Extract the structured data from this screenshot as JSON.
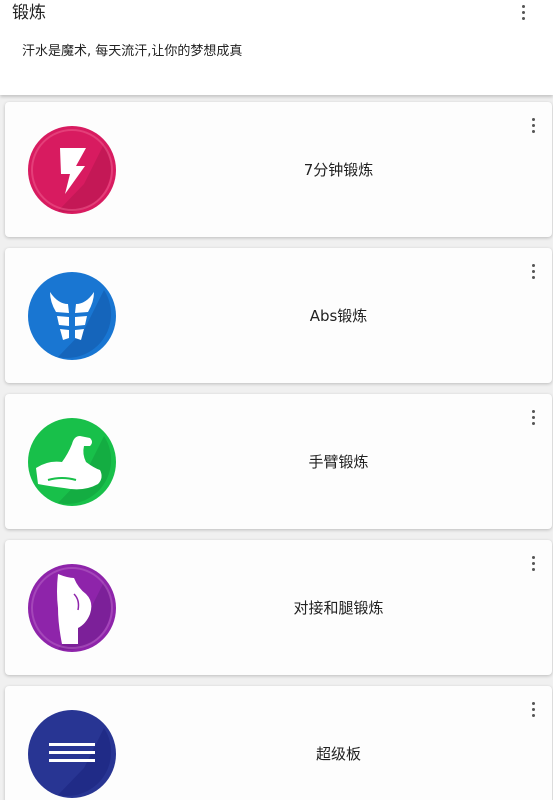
{
  "header": {
    "title": "锻炼",
    "subtitle": "汗水是魔术, 每天流汗,让你的梦想成真",
    "menu_icon": "more-vertical-icon"
  },
  "colors": {
    "background": "#f0f0f0",
    "card": "#fdfdfd",
    "text": "#222222"
  },
  "workouts": [
    {
      "label": "7分钟锻炼",
      "icon": "lightning-bolt-icon",
      "color": "#d81b60"
    },
    {
      "label": "Abs锻炼",
      "icon": "abs-icon",
      "color": "#1976d2"
    },
    {
      "label": "手臂锻炼",
      "icon": "flexed-arm-icon",
      "color": "#18c04a"
    },
    {
      "label": "对接和腿锻炼",
      "icon": "buttocks-icon",
      "color": "#8e24aa"
    },
    {
      "label": "超级板",
      "icon": "plank-lines-icon",
      "color": "#283593"
    }
  ]
}
